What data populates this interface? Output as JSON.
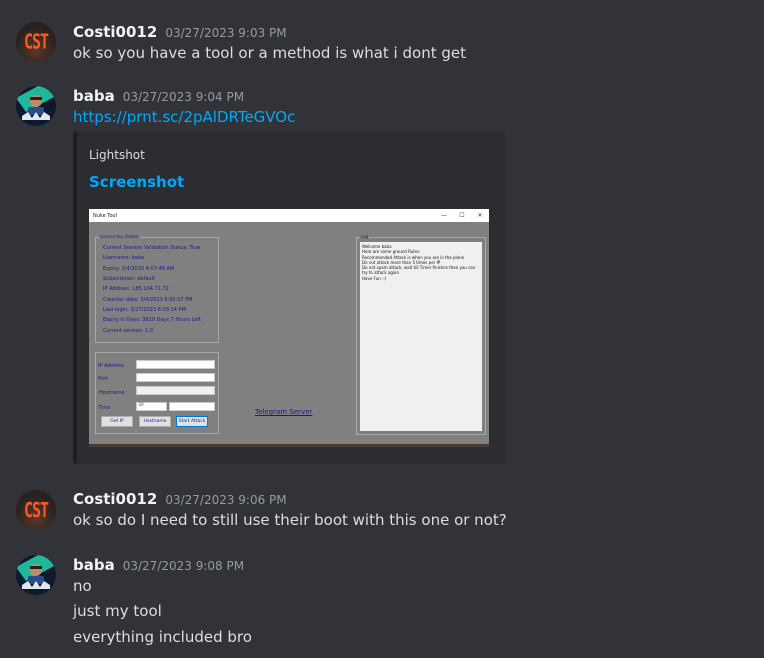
{
  "messages": [
    {
      "username": "Costi0012",
      "timestamp": "03/27/2023 9:03 PM",
      "avatar_text": "CST",
      "lines": [
        "ok so you have a tool or a method is what i dont get"
      ]
    },
    {
      "username": "baba",
      "timestamp": "03/27/2023 9:04 PM",
      "link": "https://prnt.sc/2pAlDRTeGVOc",
      "embed": {
        "provider": "Lightshot",
        "title": "Screenshot",
        "screenshot": {
          "window_title": "Nuke Tool",
          "controls": {
            "minimize": "—",
            "maximize": "☐",
            "close": "✕"
          },
          "license_group": {
            "label": "License Key Details",
            "lines": [
              "Current Session Validation Status: True",
              "Username: baba",
              "Expiry: 3/4/2033 4:07:46 AM",
              "Subscription: default",
              "IP Address: 185.104.71.72",
              "Creation date: 3/4/2023 6:00:07 PM",
              "Last login: 3/27/2023 6:03:14 PM",
              "Expiry in Days: 3629 Days 7 Hours Left",
              "Current version: 1.0"
            ]
          },
          "attack_group": {
            "ip_label": "IP Address",
            "ip_value": "",
            "port_label": "Port",
            "port_value": "",
            "hostname_label": "Hostname",
            "hostname_value": "",
            "time_label": "Time",
            "time_value": "30",
            "method_value": "",
            "buttons": [
              "Get IP",
              "Hostname",
              "Start Attack"
            ]
          },
          "telegram_link": "Telegram Server",
          "log": {
            "label": "Log",
            "text": "Welcome baba\nHere are some ground Rules:\nRecommended Attack is when you are in the plane\nDo not attack more than 5 times per IP\nDo not spam attack, wait till Timer finishes then you can try to attack again\nHave Fun :-)"
          }
        }
      }
    },
    {
      "username": "Costi0012",
      "timestamp": "03/27/2023 9:06 PM",
      "avatar_text": "CST",
      "lines": [
        "ok so do I need to still use their boot with this one or not?"
      ]
    },
    {
      "username": "baba",
      "timestamp": "03/27/2023 9:08 PM",
      "lines": [
        "no",
        "just my tool",
        "everything included bro"
      ]
    }
  ],
  "colors": {
    "background": "#313338",
    "embed_background": "#2b2d31",
    "link": "#00a8fc",
    "username": "#f2f3f5",
    "timestamp": "#949ba4",
    "text": "#dbdee1"
  }
}
